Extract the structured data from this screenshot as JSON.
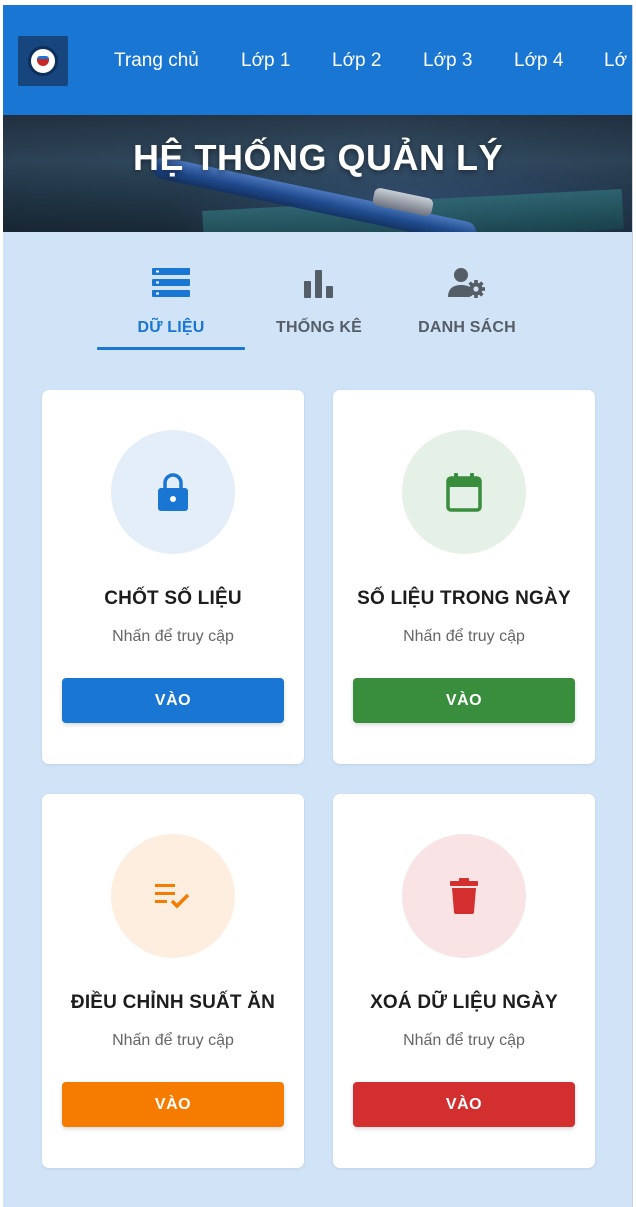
{
  "navbar": {
    "items": [
      "Trang chủ",
      "Lớp 1",
      "Lớp 2",
      "Lớp 3",
      "Lớp 4",
      "Lớ"
    ]
  },
  "hero": {
    "title": "HỆ THỐNG QUẢN LÝ"
  },
  "tabs": [
    {
      "label": "DỮ LIỆU",
      "icon": "list-icon",
      "active": true
    },
    {
      "label": "THỐNG KÊ",
      "icon": "bar-chart-icon",
      "active": false
    },
    {
      "label": "DANH SÁCH",
      "icon": "user-settings-icon",
      "active": false
    }
  ],
  "cards": [
    {
      "title": "CHỐT SỐ LIỆU",
      "subtitle": "Nhấn để truy cập",
      "button": "VÀO",
      "icon": "lock-icon",
      "color": "#1976d2",
      "circle_color": "#e3eef9"
    },
    {
      "title": "SỐ LIỆU TRONG NGÀY",
      "subtitle": "Nhấn để truy cập",
      "button": "VÀO",
      "icon": "calendar-icon",
      "color": "#388e3c",
      "circle_color": "#e5f1e6"
    },
    {
      "title": "ĐIỀU CHỈNH SUẤT ĂN",
      "subtitle": "Nhấn để truy cập",
      "button": "VÀO",
      "icon": "playlist-check-icon",
      "color": "#f57c00",
      "circle_color": "#fdeedf"
    },
    {
      "title": "XOÁ DỮ LIỆU NGÀY",
      "subtitle": "Nhấn để truy cập",
      "button": "VÀO",
      "icon": "trash-icon",
      "color": "#d32f2f",
      "circle_color": "#f9e3e4"
    }
  ]
}
